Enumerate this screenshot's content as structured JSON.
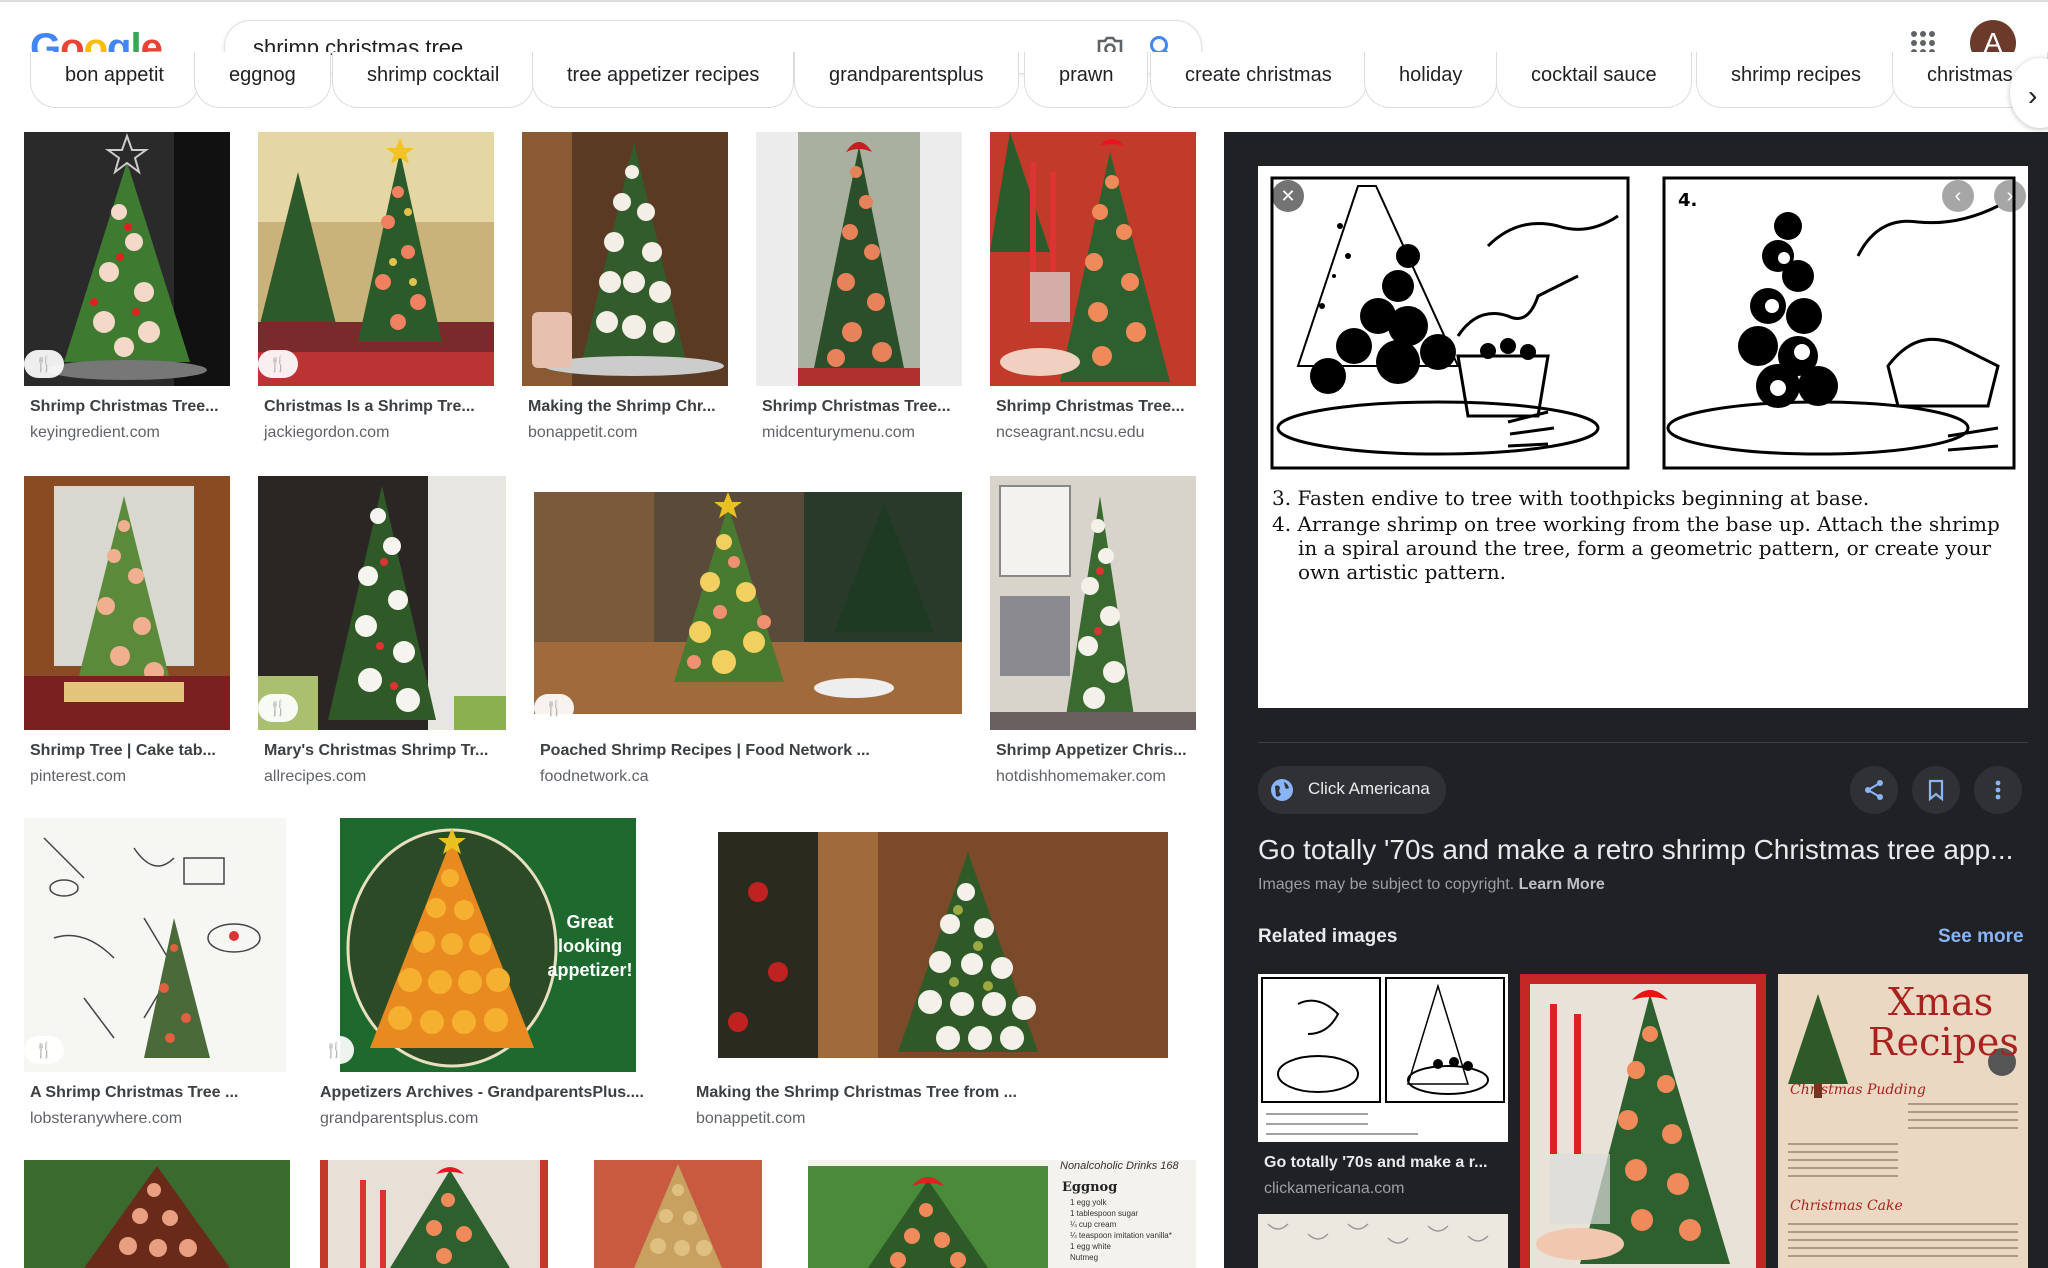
{
  "search": {
    "query": "shrimp christmas tree."
  },
  "header": {
    "logo_letters": [
      "G",
      "o",
      "o",
      "g",
      "l",
      "e"
    ],
    "logo_colors": [
      "#4285f4",
      "#ea4335",
      "#fbbc05",
      "#4285f4",
      "#34a853",
      "#ea4335"
    ],
    "avatar_letter": "A"
  },
  "chips": [
    "bon appetit",
    "eggnog",
    "shrimp cocktail",
    "tree appetizer recipes",
    "grandparentsplus",
    "prawn",
    "create christmas",
    "holiday",
    "cocktail sauce",
    "shrimp recipes",
    "christmas"
  ],
  "results": [
    {
      "title": "Shrimp Christmas Tree...",
      "source": "keyingredient.com",
      "recipe": true
    },
    {
      "title": "Christmas Is a Shrimp Tre...",
      "source": "jackiegordon.com",
      "recipe": true
    },
    {
      "title": "Making the Shrimp Chr...",
      "source": "bonappetit.com",
      "recipe": false
    },
    {
      "title": "Shrimp Christmas Tree...",
      "source": "midcenturymenu.com",
      "recipe": false
    },
    {
      "title": "Shrimp Christmas Tree...",
      "source": "ncseagrant.ncsu.edu",
      "recipe": false
    },
    {
      "title": "Shrimp Tree | Cake tab...",
      "source": "pinterest.com",
      "recipe": false
    },
    {
      "title": "Mary's Christmas Shrimp Tr...",
      "source": "allrecipes.com",
      "recipe": true
    },
    {
      "title": "Poached Shrimp Recipes | Food Network ...",
      "source": "foodnetwork.ca",
      "recipe": true
    },
    {
      "title": "Shrimp Appetizer Chris...",
      "source": "hotdishhomemaker.com",
      "recipe": false
    },
    {
      "title": "A Shrimp Christmas Tree ...",
      "source": "lobsteranywhere.com",
      "recipe": true
    },
    {
      "title": "Appetizers Archives - GrandparentsPlus....",
      "source": "grandparentsplus.com",
      "recipe": true
    },
    {
      "title": "Making the Shrimp Christmas Tree from ...",
      "source": "bonappetit.com",
      "recipe": false
    }
  ],
  "recipe_badge": "🍴",
  "overlays": {
    "great_appetizer": [
      "Great",
      "looking",
      "appetizer!"
    ],
    "nonalcoholic_header": "Nonalcoholic Drinks 168",
    "eggnog_title": "Eggnog",
    "eggnog_lines": [
      "1 egg yolk",
      "1 tablespoon sugar",
      "¼ cup cream",
      "¼ teaspoon imitation vanilla*",
      "1 egg white",
      "Nutmeg"
    ]
  },
  "panel": {
    "preview_captions": [
      "3. Fasten endive to tree with toothpicks beginning at base.",
      "4. Arrange shrimp on tree working from the base up. Attach the shrimp",
      "in a spiral around the tree, form a geometric pattern, or create your",
      "own artistic pattern."
    ],
    "frame_number": "4.",
    "source_name": "Click Americana",
    "title": "Go totally '70s and make a retro shrimp Christmas tree app...",
    "copyright_text": "Images may be subject to copyright.",
    "learn_more": "Learn More",
    "related_heading": "Related images",
    "see_more": "See more",
    "related": [
      {
        "caption": "Go totally '70s and make a r...",
        "source": "clickamericana.com"
      }
    ],
    "xmas_title": [
      "Xmas",
      "Recipes"
    ],
    "xmas_sub1": "Christmas Pudding",
    "xmas_sub2": "Christmas Cake"
  }
}
